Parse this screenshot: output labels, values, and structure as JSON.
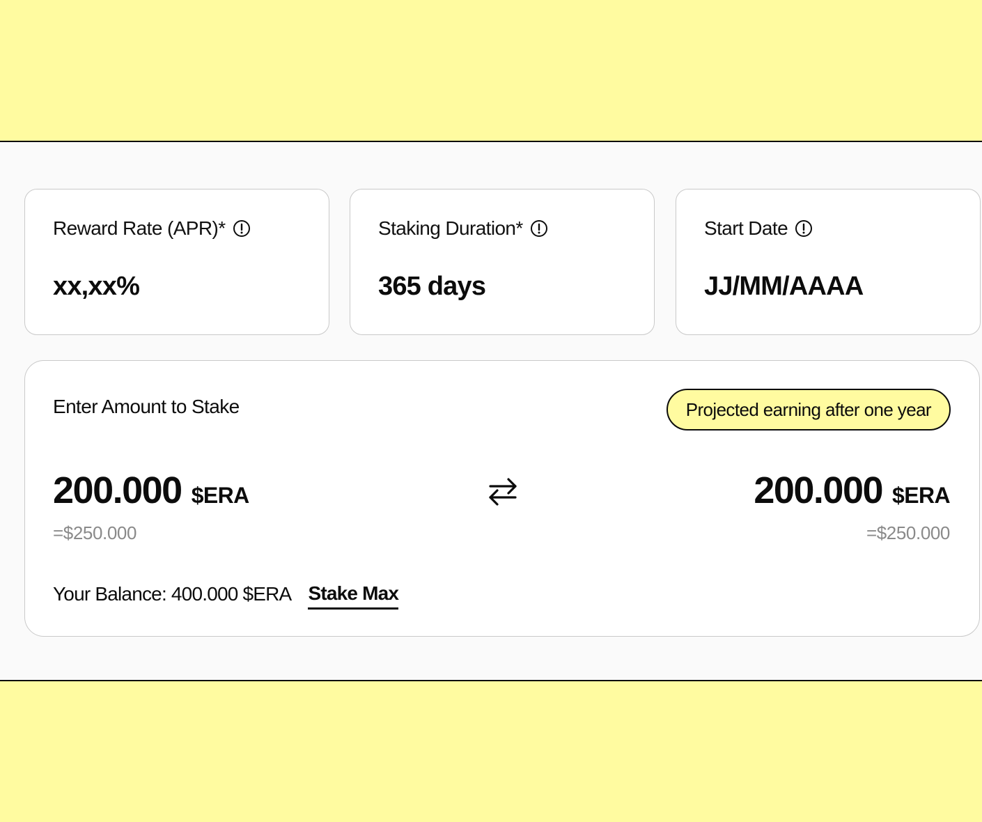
{
  "colors": {
    "background_accent": "#fffba0",
    "panel_background": "#fafafa",
    "card_background": "#ffffff",
    "text_primary": "#0c0c0c",
    "text_muted": "#8a8a8a",
    "card_border": "#c9c9c9"
  },
  "info_cards": {
    "apr": {
      "label": "Reward Rate (APR)*",
      "icon": "info-circle-icon",
      "value": "xx,xx%"
    },
    "duration": {
      "label": "Staking Duration*",
      "icon": "info-circle-icon",
      "value": "365 days"
    },
    "start_date": {
      "label": "Start Date",
      "icon": "info-circle-icon",
      "value": "JJ/MM/AAAA"
    }
  },
  "stake": {
    "title": "Enter Amount to Stake",
    "projected_label": "Projected earning after one year",
    "input_amount": "200.000",
    "input_token": "$ERA",
    "input_fiat": "=$250.000",
    "swap_icon": "swap-arrows-icon",
    "output_amount": "200.000",
    "output_token": "$ERA",
    "output_fiat": "=$250.000",
    "balance_text": "Your Balance: 400.000 $ERA",
    "stake_max_label": "Stake Max"
  }
}
